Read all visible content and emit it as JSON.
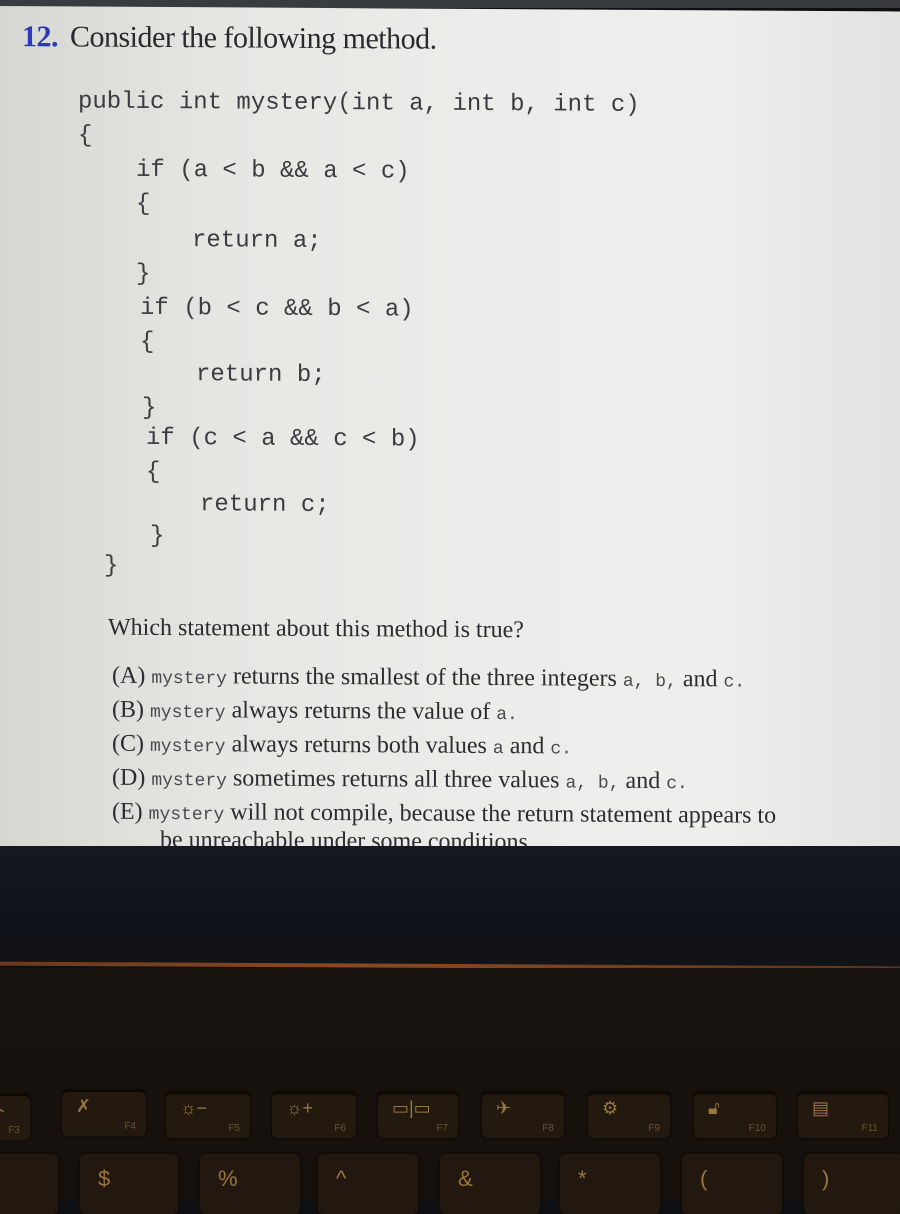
{
  "question": {
    "number": "12.",
    "prompt": "Consider the following method.",
    "code_lines": [
      "public int mystery(int a, int b, int c)",
      "{",
      "if (a < b && a < c)",
      "{",
      "return a;",
      "}",
      "if (b < c && b < a)",
      "{",
      "return b;",
      "}",
      "if (c < a && c < b)",
      "{",
      "return c;",
      "}",
      "}"
    ],
    "stem": "Which statement about this method is true?",
    "options": [
      {
        "letter": "(A)",
        "code": "mystery",
        "text": " returns the smallest of the three integers ",
        "tail_code": "a, b,",
        "tail": " and ",
        "end_code": "c."
      },
      {
        "letter": "(B)",
        "code": "mystery",
        "text": " always returns the value of ",
        "tail_code": "a.",
        "tail": "",
        "end_code": ""
      },
      {
        "letter": "(C)",
        "code": "mystery",
        "text": " always returns both values ",
        "tail_code": "a",
        "tail": " and ",
        "end_code": "c."
      },
      {
        "letter": "(D)",
        "code": "mystery",
        "text": " sometimes returns all three values ",
        "tail_code": "a, b,",
        "tail": " and ",
        "end_code": "c."
      },
      {
        "letter": "(E)",
        "code": "mystery",
        "text": " will not compile, because the return statement appears to",
        "continuation": "be unreachable under some conditions."
      }
    ]
  },
  "keyboard": {
    "function_keys": [
      {
        "label": "F3",
        "icon": "mic-off-icon",
        "glyph": "⌁"
      },
      {
        "label": "F4",
        "icon": "mic-mute-icon",
        "glyph": "✗"
      },
      {
        "label": "F5",
        "icon": "brightness-down-icon",
        "glyph": "☼−"
      },
      {
        "label": "F6",
        "icon": "brightness-up-icon",
        "glyph": "☼+"
      },
      {
        "label": "F7",
        "icon": "display-switch-icon",
        "glyph": "▭|▭"
      },
      {
        "label": "F8",
        "icon": "airplane-mode-icon",
        "glyph": "✈"
      },
      {
        "label": "F9",
        "icon": "settings-icon",
        "glyph": "⚙"
      },
      {
        "label": "F10",
        "icon": "lock-icon",
        "glyph": "🔓︎"
      },
      {
        "label": "F11",
        "icon": "keyboard-icon",
        "glyph": "▤"
      }
    ],
    "number_keys": [
      {
        "name": "key-4",
        "glyph": "$"
      },
      {
        "name": "key-5",
        "glyph": "%"
      },
      {
        "name": "key-6",
        "glyph": "^"
      },
      {
        "name": "key-7",
        "glyph": "&"
      },
      {
        "name": "key-8",
        "glyph": "*"
      },
      {
        "name": "key-9",
        "glyph": "("
      },
      {
        "name": "key-0",
        "glyph": ")"
      }
    ]
  }
}
